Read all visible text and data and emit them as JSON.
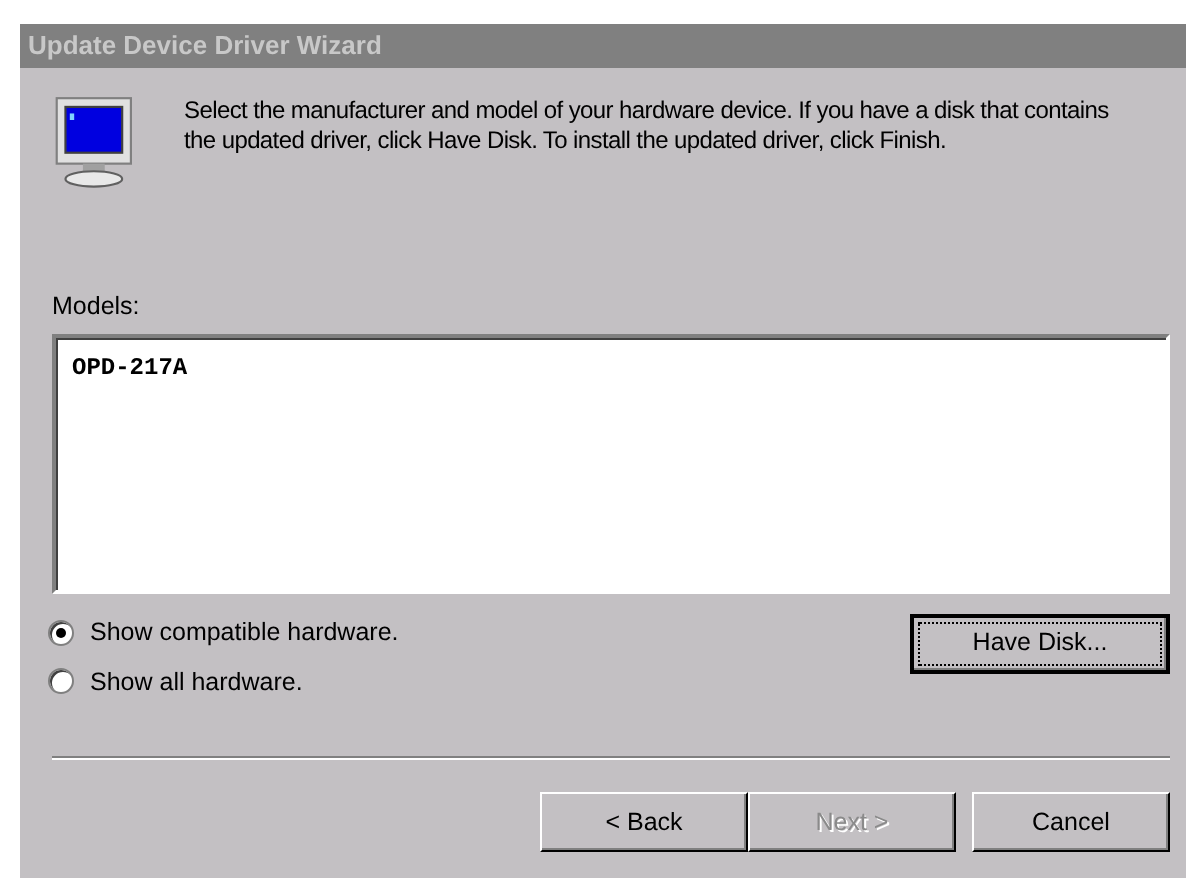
{
  "window": {
    "title": "Update Device Driver Wizard",
    "active": false
  },
  "instructions": "Select the manufacturer and model of your hardware device. If you have a disk that contains the updated driver, click Have Disk. To install the updated driver, click Finish.",
  "models": {
    "label": "Models:",
    "items": [
      {
        "text": "OPD-217A",
        "selected": false
      }
    ]
  },
  "filter_options": [
    {
      "label": "Show compatible hardware.",
      "selected": true
    },
    {
      "label": "Show all hardware.",
      "selected": false
    }
  ],
  "have_disk_button": {
    "label": "Have Disk...",
    "focused": true
  },
  "buttons": [
    {
      "label": "< Back",
      "disabled": false
    },
    {
      "label": "Next >",
      "disabled": true
    },
    {
      "label": "Cancel",
      "disabled": false
    }
  ]
}
